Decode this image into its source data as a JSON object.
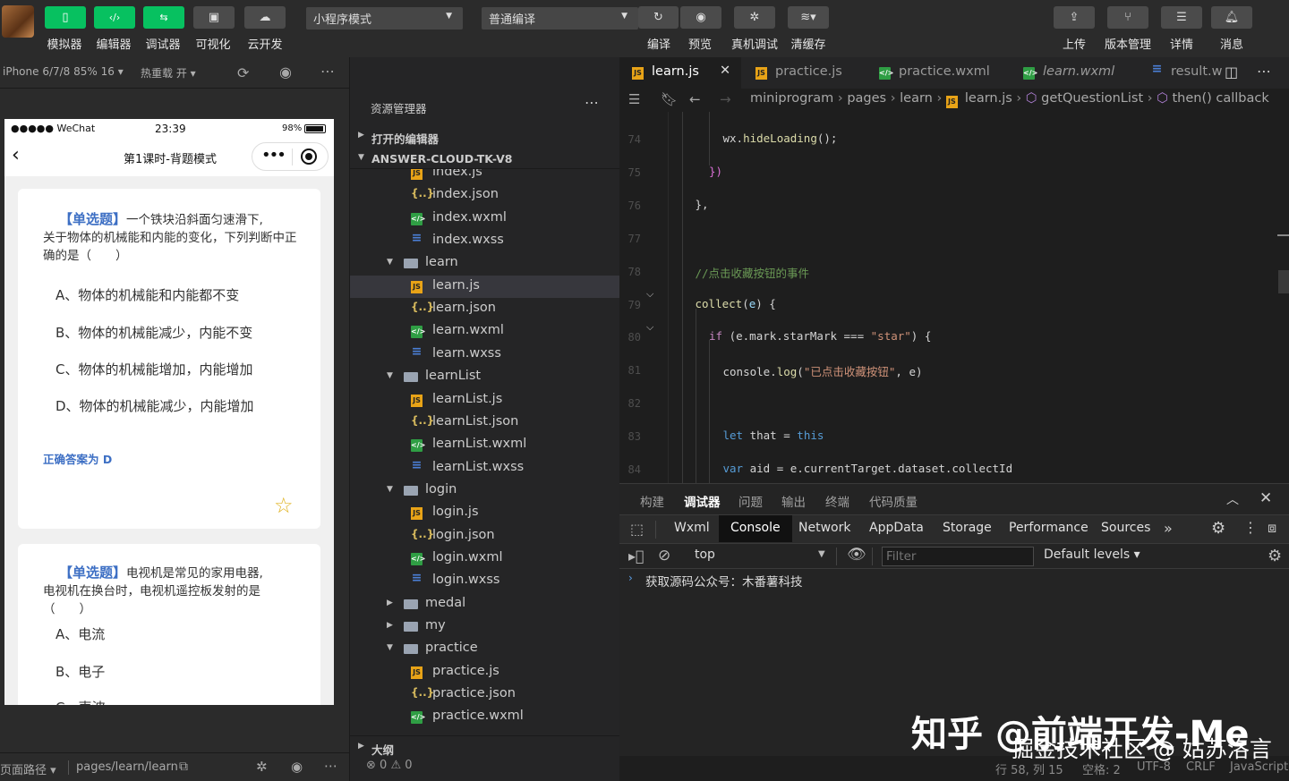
{
  "toolbar": {
    "buttons": [
      {
        "label": "模拟器",
        "icon": "phone-icon"
      },
      {
        "label": "编辑器",
        "icon": "code-icon"
      },
      {
        "label": "调试器",
        "icon": "debug-icon"
      },
      {
        "label": "可视化",
        "icon": "layout-icon"
      },
      {
        "label": "云开发",
        "icon": "cloud-icon"
      }
    ],
    "mode_select": "小程序模式",
    "compile_select": "普通编译",
    "actions": [
      {
        "label": "编译",
        "icon": "refresh-icon"
      },
      {
        "label": "预览",
        "icon": "eye-icon"
      },
      {
        "label": "真机调试",
        "icon": "bug-icon"
      },
      {
        "label": "清缓存",
        "icon": "layers-icon"
      }
    ],
    "right_actions": [
      {
        "label": "上传",
        "icon": "upload-icon"
      },
      {
        "label": "版本管理",
        "icon": "branch-icon"
      },
      {
        "label": "详情",
        "icon": "menu-icon"
      },
      {
        "label": "消息",
        "icon": "bell-icon"
      }
    ]
  },
  "subbar": {
    "device": "iPhone 6/7/8 85% 16",
    "hot_reload": "热重载 开"
  },
  "phone": {
    "carrier": "●●●●● WeChat",
    "time": "23:39",
    "battery": "98%",
    "nav_title": "第1课时-背题模式",
    "cards": [
      {
        "tag": "【单选题】",
        "question_line1": "一个铁块沿斜面匀速滑下,",
        "question_rest": "关于物体的机械能和内能的变化，下列判断中正确的是（　　）",
        "options": [
          "A、物体的机械能和内能都不变",
          "B、物体的机械能减少，内能不变",
          "C、物体的机械能增加，内能增加",
          "D、物体的机械能减少，内能增加"
        ],
        "answer": "正确答案为 D"
      },
      {
        "tag": "【单选题】",
        "question_line1": "电视机是常见的家用电器,",
        "question_rest": "电视机在换台时，电视机遥控板发射的是（　　）",
        "options": [
          "A、电流",
          "B、电子",
          "C、声波"
        ]
      }
    ]
  },
  "simstatus": {
    "path_label": "页面路径",
    "path": "pages/learn/learn"
  },
  "explorer": {
    "title": "资源管理器",
    "open_editors": "打开的编辑器",
    "project": "ANSWER-CLOUD-TK-V8",
    "outline": "大纲",
    "errors": "0",
    "warnings": "0",
    "files": [
      {
        "name": "index.js",
        "type": "js",
        "indent": 2
      },
      {
        "name": "index.json",
        "type": "json",
        "indent": 2
      },
      {
        "name": "index.wxml",
        "type": "wxml",
        "indent": 2
      },
      {
        "name": "index.wxss",
        "type": "wxss",
        "indent": 2
      },
      {
        "name": "learn",
        "type": "folder-open",
        "indent": 1
      },
      {
        "name": "learn.js",
        "type": "js",
        "indent": 2,
        "selected": true
      },
      {
        "name": "learn.json",
        "type": "json",
        "indent": 2
      },
      {
        "name": "learn.wxml",
        "type": "wxml",
        "indent": 2
      },
      {
        "name": "learn.wxss",
        "type": "wxss",
        "indent": 2
      },
      {
        "name": "learnList",
        "type": "folder-open",
        "indent": 1
      },
      {
        "name": "learnList.js",
        "type": "js",
        "indent": 2
      },
      {
        "name": "learnList.json",
        "type": "json",
        "indent": 2
      },
      {
        "name": "learnList.wxml",
        "type": "wxml",
        "indent": 2
      },
      {
        "name": "learnList.wxss",
        "type": "wxss",
        "indent": 2
      },
      {
        "name": "login",
        "type": "folder-open",
        "indent": 1
      },
      {
        "name": "login.js",
        "type": "js",
        "indent": 2
      },
      {
        "name": "login.json",
        "type": "json",
        "indent": 2
      },
      {
        "name": "login.wxml",
        "type": "wxml",
        "indent": 2
      },
      {
        "name": "login.wxss",
        "type": "wxss",
        "indent": 2
      },
      {
        "name": "medal",
        "type": "folder",
        "indent": 1
      },
      {
        "name": "my",
        "type": "folder",
        "indent": 1
      },
      {
        "name": "practice",
        "type": "folder-open",
        "indent": 1
      },
      {
        "name": "practice.js",
        "type": "js",
        "indent": 2
      },
      {
        "name": "practice.json",
        "type": "json",
        "indent": 2
      },
      {
        "name": "practice.wxml",
        "type": "wxml",
        "indent": 2
      }
    ]
  },
  "editor": {
    "tabs": [
      {
        "name": "learn.js",
        "type": "js",
        "active": true
      },
      {
        "name": "practice.js",
        "type": "js"
      },
      {
        "name": "practice.wxml",
        "type": "wxml"
      },
      {
        "name": "learn.wxml",
        "type": "wxml",
        "italic": true
      },
      {
        "name": "result.w",
        "type": "wxss"
      }
    ],
    "breadcrumb": [
      "miniprogram",
      "pages",
      "learn",
      "learn.js",
      "getQuestionList",
      "then() callback"
    ],
    "lines": [
      {
        "n": "74",
        "indent": 3,
        "parts": [
          [
            "wx.",
            "#d4d4d4"
          ],
          [
            "hideLoading",
            "#dcdcaa"
          ],
          [
            "();",
            "#d4d4d4"
          ]
        ]
      },
      {
        "n": "75",
        "indent": 2,
        "parts": [
          [
            "})",
            "#da70d6"
          ]
        ]
      },
      {
        "n": "76",
        "indent": 1,
        "parts": [
          [
            "},",
            "#d4d4d4"
          ]
        ]
      },
      {
        "n": "77",
        "indent": 0,
        "parts": []
      },
      {
        "n": "78",
        "indent": 1,
        "parts": [
          [
            "//点击收藏按钮的事件",
            "#6a9955"
          ]
        ]
      },
      {
        "n": "79",
        "indent": 1,
        "parts": [
          [
            "collect",
            "#dcdcaa"
          ],
          [
            "(",
            "#d4d4d4"
          ],
          [
            "e",
            "#9cdcfe"
          ],
          [
            ") {",
            "#d4d4d4"
          ]
        ]
      },
      {
        "n": "80",
        "indent": 2,
        "parts": [
          [
            "if",
            "#c586c0"
          ],
          [
            " (e.mark.starMark === ",
            "#d4d4d4"
          ],
          [
            "\"star\"",
            "#ce9178"
          ],
          [
            ") {",
            "#d4d4d4"
          ]
        ]
      },
      {
        "n": "81",
        "indent": 3,
        "parts": [
          [
            "console.",
            "#d4d4d4"
          ],
          [
            "log",
            "#dcdcaa"
          ],
          [
            "(",
            "#d4d4d4"
          ],
          [
            "\"已点击收藏按钮\"",
            "#ce9178"
          ],
          [
            ", e)",
            "#d4d4d4"
          ]
        ]
      },
      {
        "n": "82",
        "indent": 0,
        "parts": []
      },
      {
        "n": "83",
        "indent": 3,
        "parts": [
          [
            "let",
            "#569cd6"
          ],
          [
            " that = ",
            "#d4d4d4"
          ],
          [
            "this",
            "#569cd6"
          ]
        ]
      },
      {
        "n": "84",
        "indent": 3,
        "parts": [
          [
            "var",
            "#569cd6"
          ],
          [
            " aid = e.currentTarget.dataset.collectId",
            "#d4d4d4"
          ]
        ]
      }
    ]
  },
  "debug": {
    "panel_tabs": [
      "构建",
      "调试器",
      "问题",
      "输出",
      "终端",
      "代码质量"
    ],
    "active_panel": "调试器",
    "devtools_tabs": [
      "Wxml",
      "Console",
      "Network",
      "AppData",
      "Storage",
      "Performance",
      "Sources"
    ],
    "active_devtool": "Console",
    "context": "top",
    "filter_placeholder": "Filter",
    "levels": "Default levels",
    "console_message": "获取源码公众号：木番薯科技"
  },
  "statusbar": {
    "position": "行 58, 列 15",
    "spaces": "空格: 2",
    "encoding": "UTF-8",
    "eol": "CRLF",
    "language": "JavaScript"
  },
  "watermark": {
    "line1": "知乎 @前端开发-Me",
    "line2": "掘金技术社区 @ 姑苏洛言"
  },
  "colors": {
    "accent_green": "#07c160",
    "question_blue": "#3d6fc4",
    "editor_bg": "#1e1e1e"
  }
}
